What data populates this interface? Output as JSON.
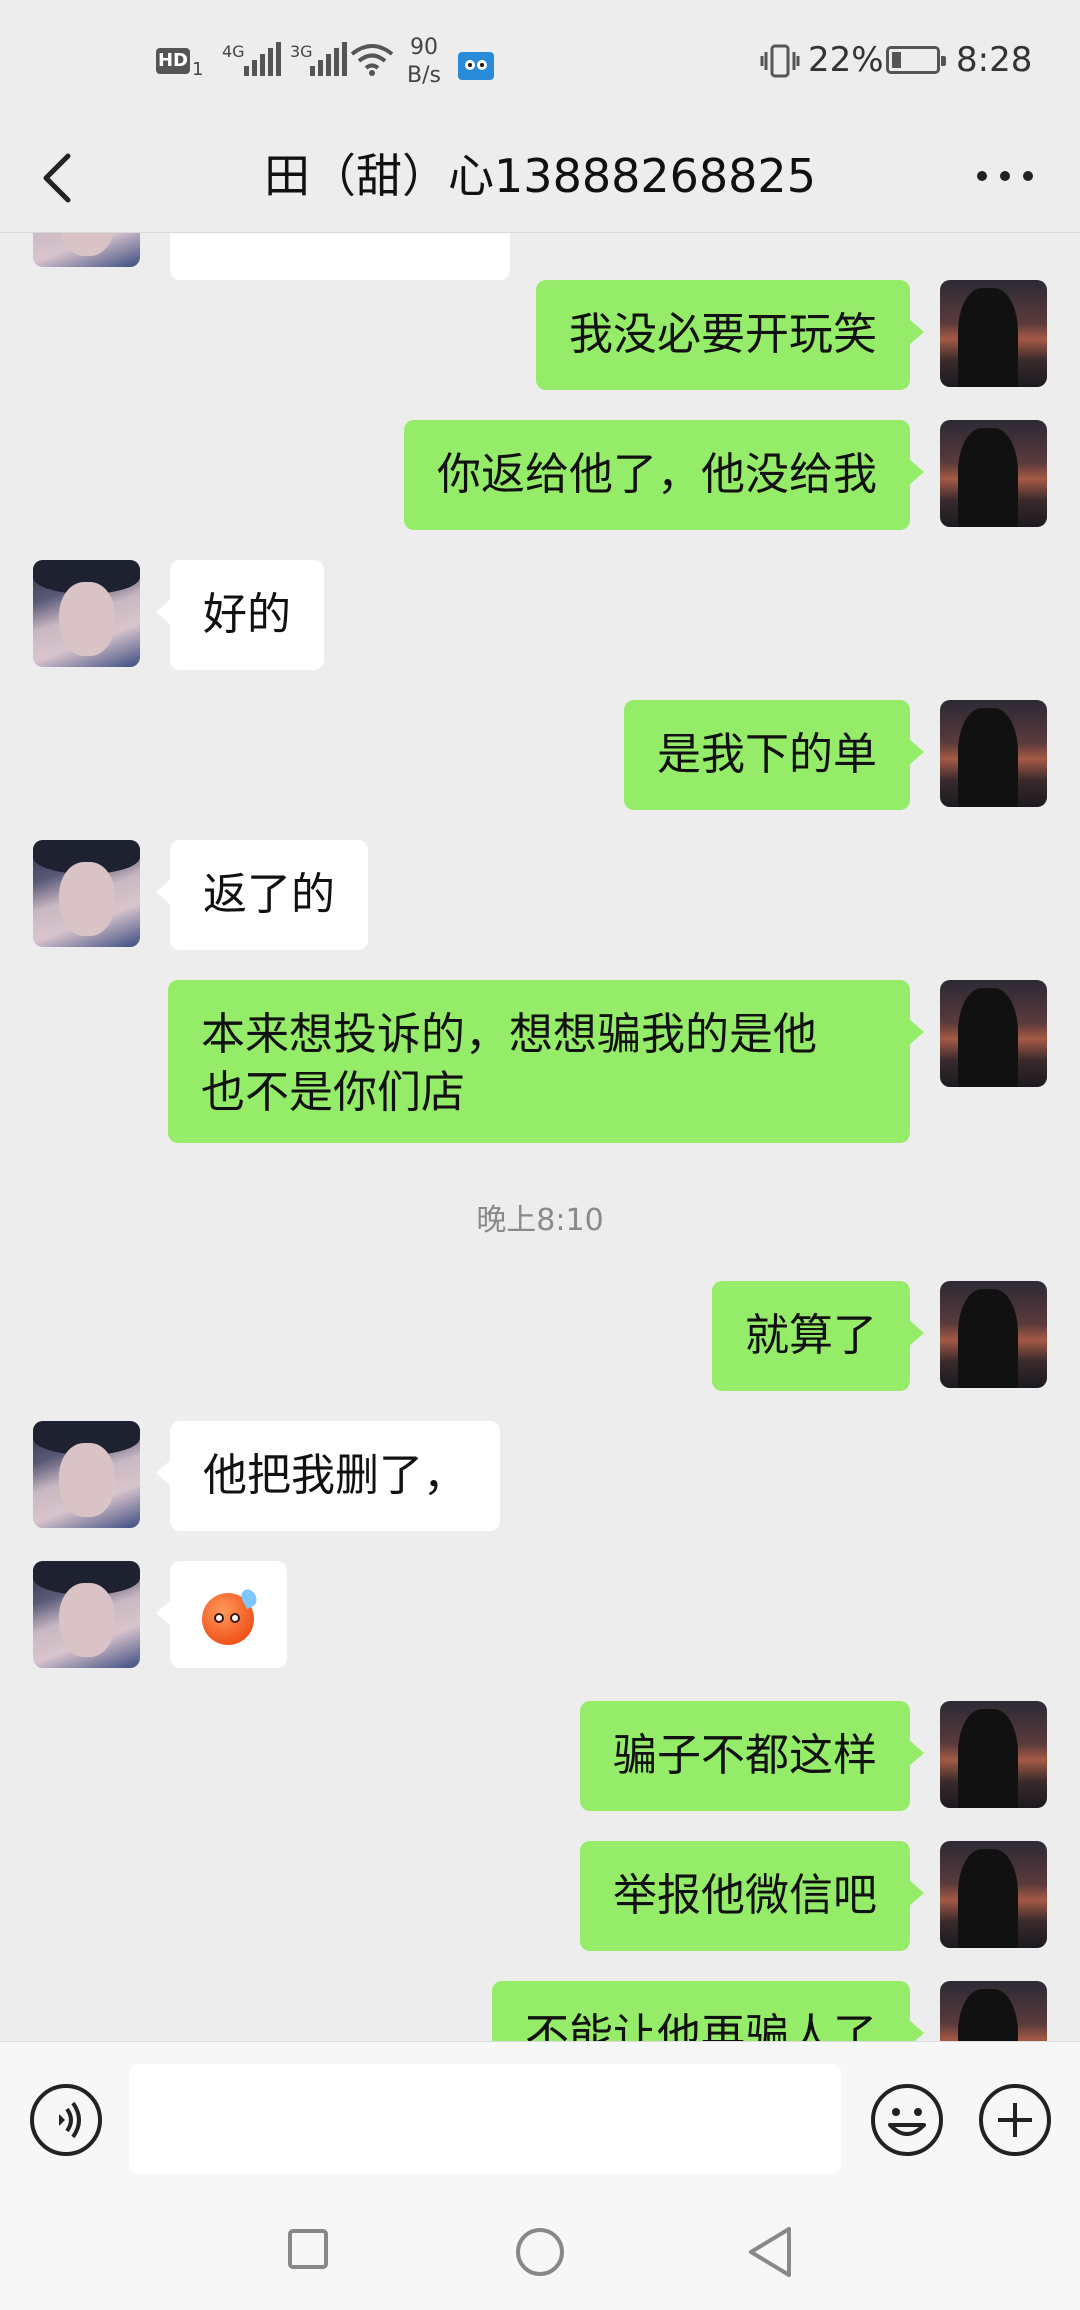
{
  "status_bar": {
    "hd": "HD",
    "hd_sub": "1",
    "net1": "4G",
    "net2": "3G",
    "speed_value": "90",
    "speed_unit": "B/s",
    "battery": "22%",
    "battery_level": 0.22,
    "time": "8:28"
  },
  "header": {
    "title": "田（甜）心13888268825"
  },
  "messages": [
    {
      "side": "other",
      "text": ""
    },
    {
      "side": "self",
      "text": "我没必要开玩笑"
    },
    {
      "side": "self",
      "text": "你返给他了，他没给我"
    },
    {
      "side": "other",
      "text": "好的"
    },
    {
      "side": "self",
      "text": "是我下的单"
    },
    {
      "side": "other",
      "text": "返了的"
    },
    {
      "side": "self",
      "text": "本来想投诉的，想想骗我的是他也不是你们店"
    },
    {
      "side": "self",
      "text": "就算了"
    },
    {
      "side": "other",
      "text": "他把我删了，"
    },
    {
      "side": "other",
      "emoji": "sweat-face-emoji"
    },
    {
      "side": "self",
      "text": "骗子不都这样"
    },
    {
      "side": "self",
      "text": "举报他微信吧"
    },
    {
      "side": "self",
      "text": "不能让他再骗人了"
    }
  ],
  "timestamp": "晚上8:10",
  "input_bar": {
    "value": "",
    "icons": [
      "voice-icon",
      "emoji-icon",
      "plus-icon"
    ]
  },
  "nav_bar": {
    "icons": [
      "recent-apps-icon",
      "home-icon",
      "back-icon"
    ]
  }
}
